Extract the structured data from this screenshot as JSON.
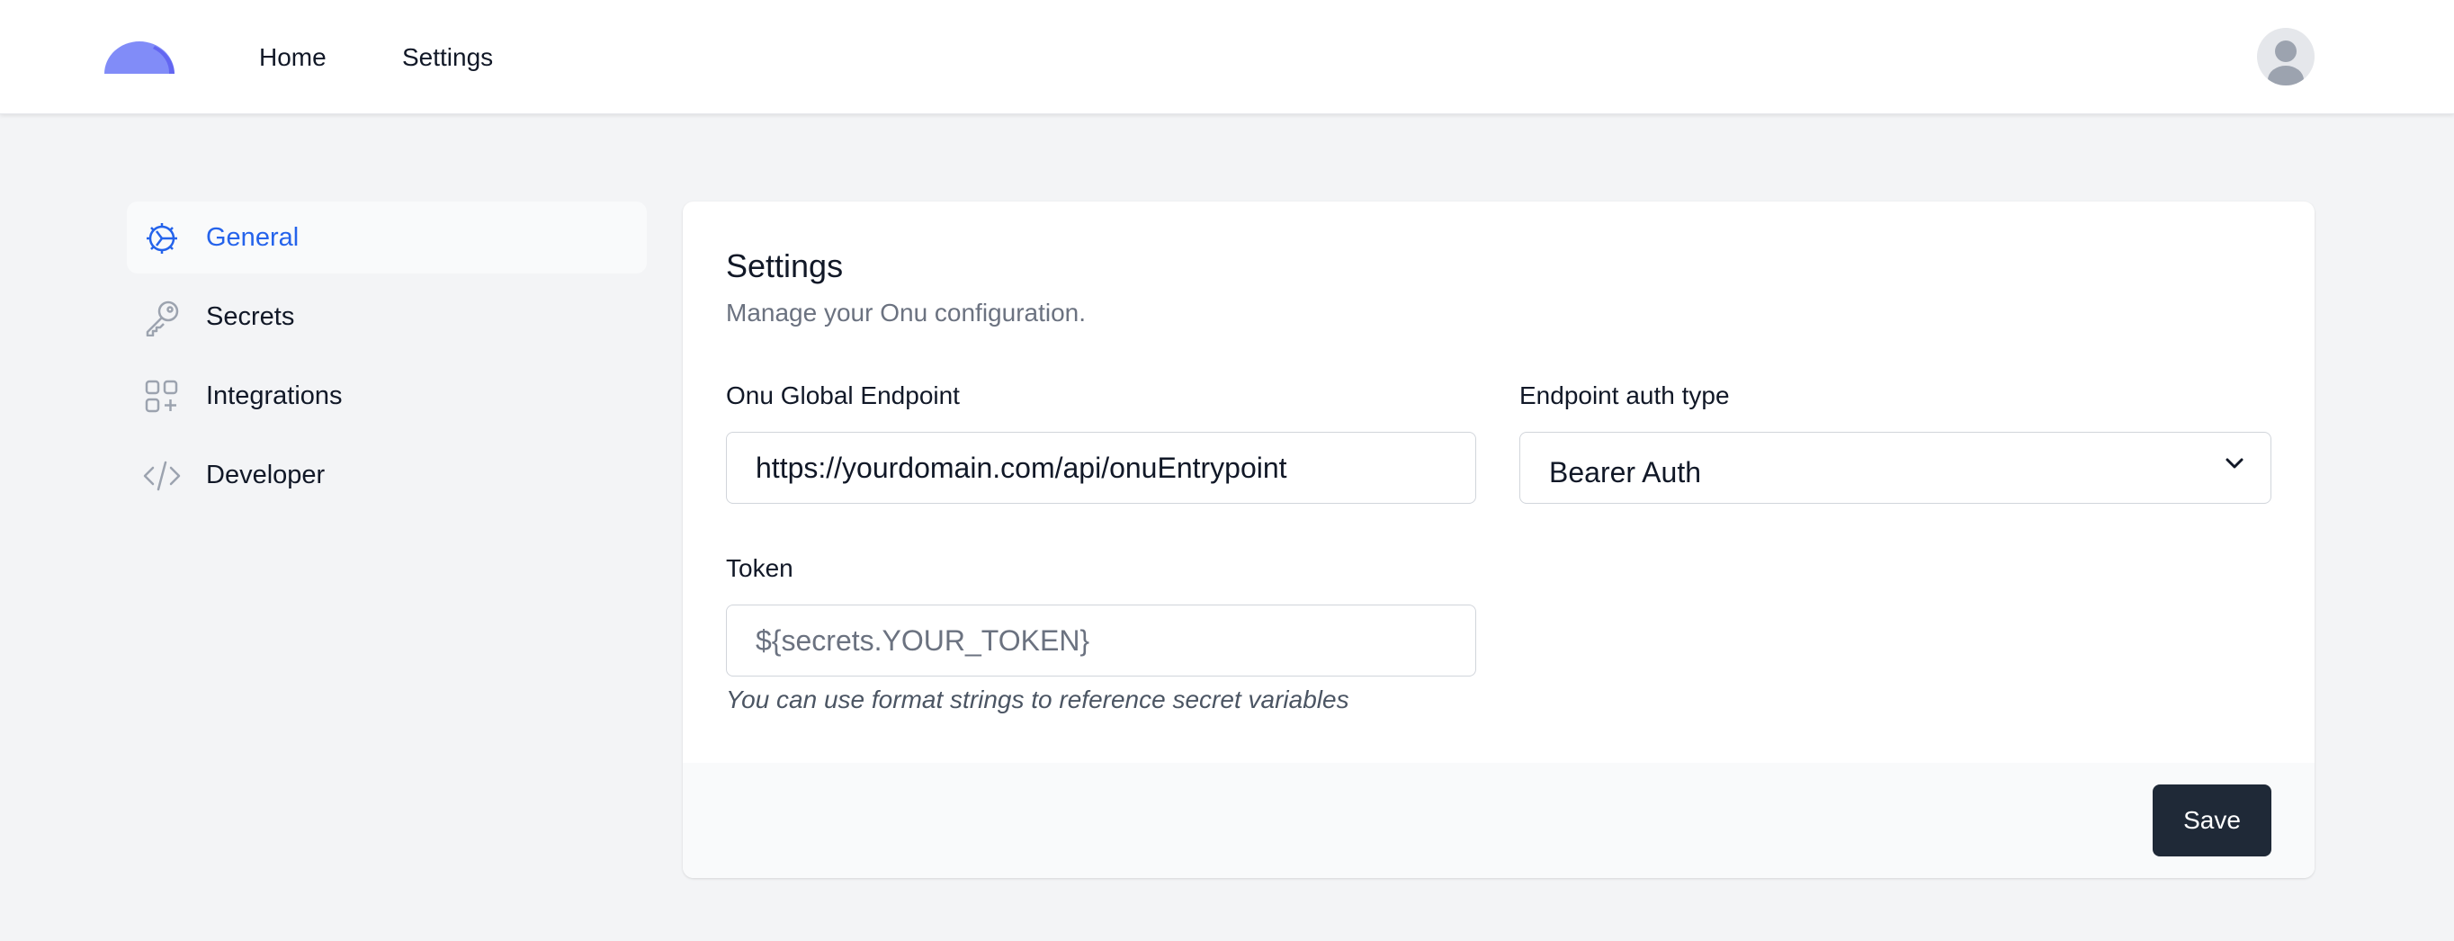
{
  "topbar": {
    "nav": [
      {
        "label": "Home"
      },
      {
        "label": "Settings"
      }
    ],
    "logo_icon": "half-circle-logo",
    "avatar_icon": "user-avatar-icon"
  },
  "sidebar": {
    "items": [
      {
        "label": "General",
        "icon": "gear-icon",
        "active": true
      },
      {
        "label": "Secrets",
        "icon": "key-icon",
        "active": false
      },
      {
        "label": "Integrations",
        "icon": "squares-plus-icon",
        "active": false
      },
      {
        "label": "Developer",
        "icon": "code-icon",
        "active": false
      }
    ]
  },
  "card": {
    "title": "Settings",
    "subtitle": "Manage your Onu configuration.",
    "endpoint": {
      "label": "Onu Global Endpoint",
      "value": "https://yourdomain.com/api/onuEntrypoint"
    },
    "auth_type": {
      "label": "Endpoint auth type",
      "selected": "Bearer Auth"
    },
    "token": {
      "label": "Token",
      "placeholder": "${secrets.YOUR_TOKEN}",
      "hint": "You can use format strings to reference secret variables"
    },
    "save_label": "Save"
  },
  "colors": {
    "accent": "#2563eb",
    "logo": "#818cf8",
    "save_button": "#1f2937",
    "background": "#f3f4f6"
  }
}
